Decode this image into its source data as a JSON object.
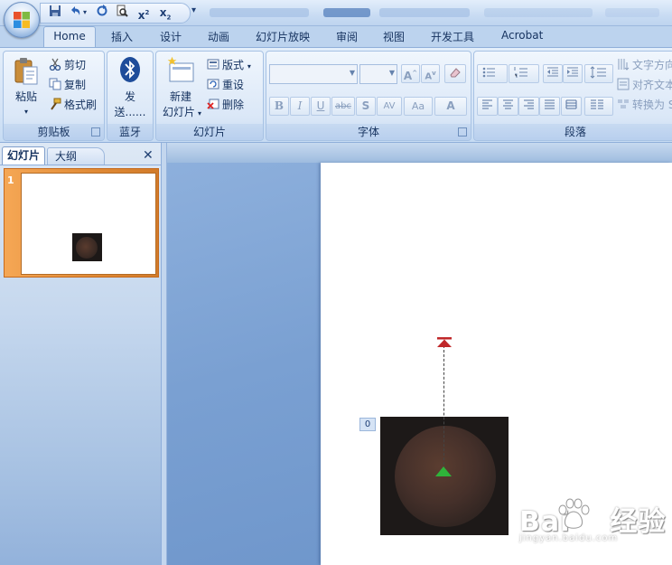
{
  "quick_access": {
    "undo_dropdown": "▾",
    "superscript_base": "x",
    "superscript_exp": "2",
    "subscript_base": "x",
    "subscript_sub": "2",
    "customize_arrow": "▾"
  },
  "tabs": [
    {
      "label": "Home",
      "active": true
    },
    {
      "label": "插入"
    },
    {
      "label": "设计"
    },
    {
      "label": "动画"
    },
    {
      "label": "幻灯片放映"
    },
    {
      "label": "审阅"
    },
    {
      "label": "视图"
    },
    {
      "label": "开发工具"
    },
    {
      "label": "Acrobat"
    }
  ],
  "ribbon": {
    "clipboard": {
      "paste": "粘贴",
      "paste_arrow": "▾",
      "cut": "剪切",
      "copy": "复制",
      "format_painter": "格式刷",
      "label": "剪贴板"
    },
    "bluetooth": {
      "send_line1": "发",
      "send_line2": "送......",
      "label": "蓝牙"
    },
    "slides": {
      "new_slide_line1": "新建",
      "new_slide_line2": "幻灯片",
      "new_slide_arrow": "▾",
      "layout": "版式",
      "layout_arrow": "▾",
      "reset": "重设",
      "delete": "删除",
      "label": "幻灯片"
    },
    "font": {
      "font_name_value": "",
      "font_size_value": "",
      "grow": "A",
      "grow_sup": "^",
      "shrink": "A",
      "shrink_sup": "v",
      "bold": "B",
      "italic": "I",
      "underline": "U",
      "strike": "abc",
      "shadow": "S",
      "spacing": "AV",
      "case": "Aa",
      "color": "A",
      "label": "字体"
    },
    "paragraph": {
      "text_direction": "文字方向",
      "align_text": "对齐文本",
      "convert": "转换为 S",
      "label": "段落"
    }
  },
  "left_pane": {
    "tab_slides": "幻灯片",
    "tab_outline": "大纲",
    "close": "✕",
    "thumbnail_number": "1"
  },
  "slide": {
    "animation_order": "0"
  },
  "watermark": {
    "text_left": "Bai",
    "text_right": "经验",
    "url": "jingyan.baidu.com"
  },
  "colors": {
    "accent": "#dfeaf8",
    "thumb_selected": "#e08a35",
    "end_marker": "#c0282a",
    "start_marker": "#2fb43a"
  }
}
